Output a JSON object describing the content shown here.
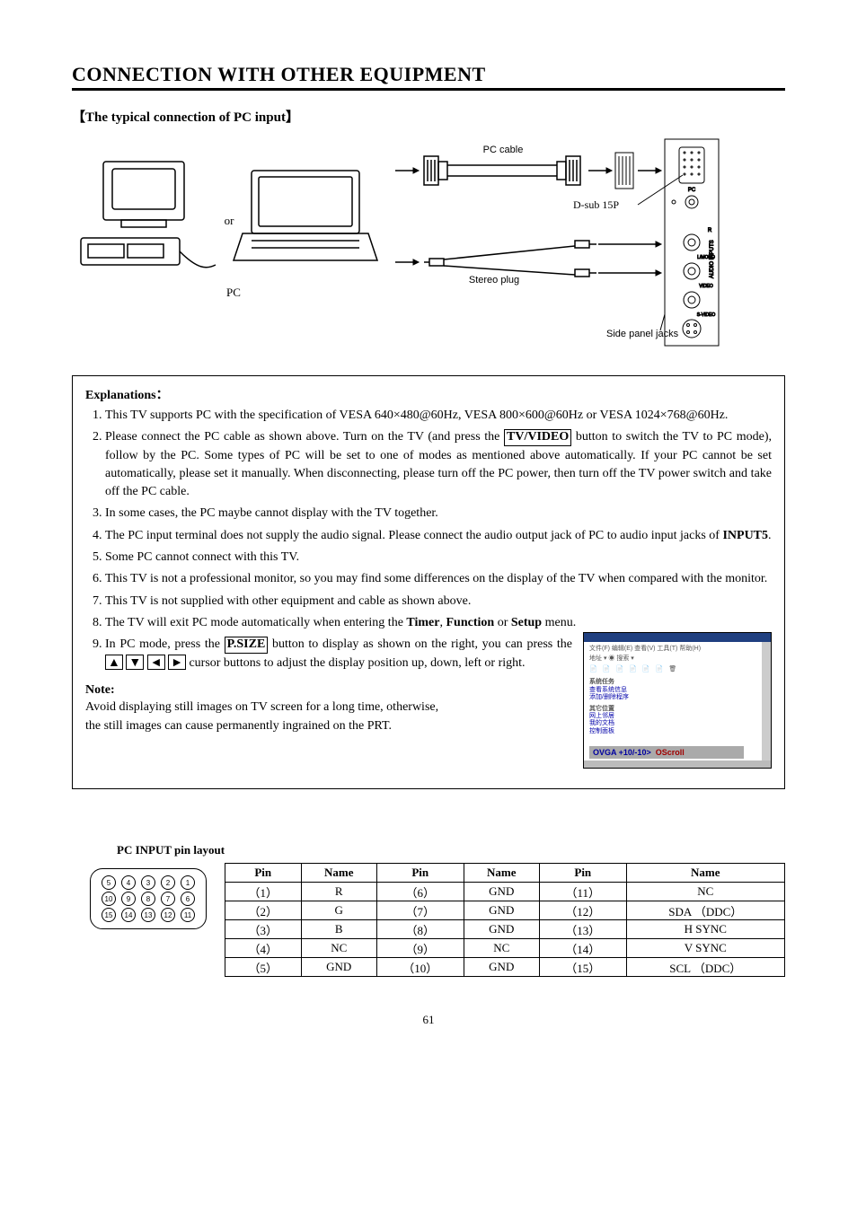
{
  "header": "CONNECTION WITH OTHER EQUIPMENT",
  "subhead": "The typical connection of PC input",
  "diagram": {
    "or": "or",
    "pc": "PC",
    "pc_cable": "PC cable",
    "dsub": "D-sub 15P",
    "stereo": "Stereo plug",
    "side_panel": "Side panel jacks"
  },
  "explain_title": "Explanations：",
  "explain": [
    "This TV supports PC with the specification of VESA 640×480@60Hz, VESA 800×600@60Hz or VESA 1024×768@60Hz.",
    {
      "pre": "Please connect the PC cable as shown above. Turn on the TV (and press the ",
      "btn": "TV/VIDEO",
      "post": " button to switch the TV to PC mode), follow by the PC. Some types of PC will be set to one of modes as mentioned above automatically. If your PC cannot be set automatically, please set it manually. When disconnecting, please turn off the PC power, then turn off the TV power switch and take off the PC cable."
    },
    "In some cases, the PC maybe cannot display with the TV together.",
    {
      "pre": "The PC input terminal does not supply the audio signal. Please connect the audio output jack of PC to audio input jacks of ",
      "bold": "INPUT5",
      "post": "."
    },
    "Some PC cannot connect with this TV.",
    "This TV is not a professional monitor, so you may find some differences on the display of the TV when compared with the monitor.",
    "This TV is not supplied with other equipment and cable as shown above.",
    {
      "pre": "The TV will exit PC mode automatically when entering the ",
      "b1": "Timer",
      "sep1": ", ",
      "b2": "Function",
      "sep2": " or ",
      "b3": "Setup",
      "post": " menu."
    },
    {
      "pre": "In PC mode, press the ",
      "btn": "P.SIZE",
      "mid": " button to display as shown on the right, you can press the ",
      "a1": "▲",
      "a2": "▼",
      "a3": "◄",
      "a4": "►",
      "post": " cursor buttons to adjust the display position up, down, left or right."
    }
  ],
  "screenshot": {
    "ovga": "OVGA +10/-10>",
    "oscroll": "OScroll"
  },
  "note": {
    "head": "Note:",
    "line1": "Avoid displaying still images on TV screen for a long time, otherwise,",
    "line2": "the still images can cause permanently ingrained on the PRT."
  },
  "pin_section_title": "PC INPUT pin layout",
  "pin_layout": {
    "row1": [
      "5",
      "4",
      "3",
      "2",
      "1"
    ],
    "row2": [
      "10",
      "9",
      "8",
      "7",
      "6"
    ],
    "row3": [
      "15",
      "14",
      "13",
      "12",
      "11"
    ]
  },
  "pin_table": {
    "headers": [
      "Pin",
      "Name",
      "Pin",
      "Name",
      "Pin",
      "Name"
    ],
    "rows": [
      [
        "（1）",
        "R",
        "（6）",
        "GND",
        "（11）",
        "NC"
      ],
      [
        "（2）",
        "G",
        "（7）",
        "GND",
        "（12）",
        "SDA （DDC）"
      ],
      [
        "（3）",
        "B",
        "（8）",
        "GND",
        "（13）",
        "H SYNC"
      ],
      [
        "（4）",
        "NC",
        "（9）",
        "NC",
        "（14）",
        "V SYNC"
      ],
      [
        "（5）",
        "GND",
        "（10）",
        "GND",
        "（15）",
        "SCL （DDC）"
      ]
    ]
  },
  "page_number": "61"
}
